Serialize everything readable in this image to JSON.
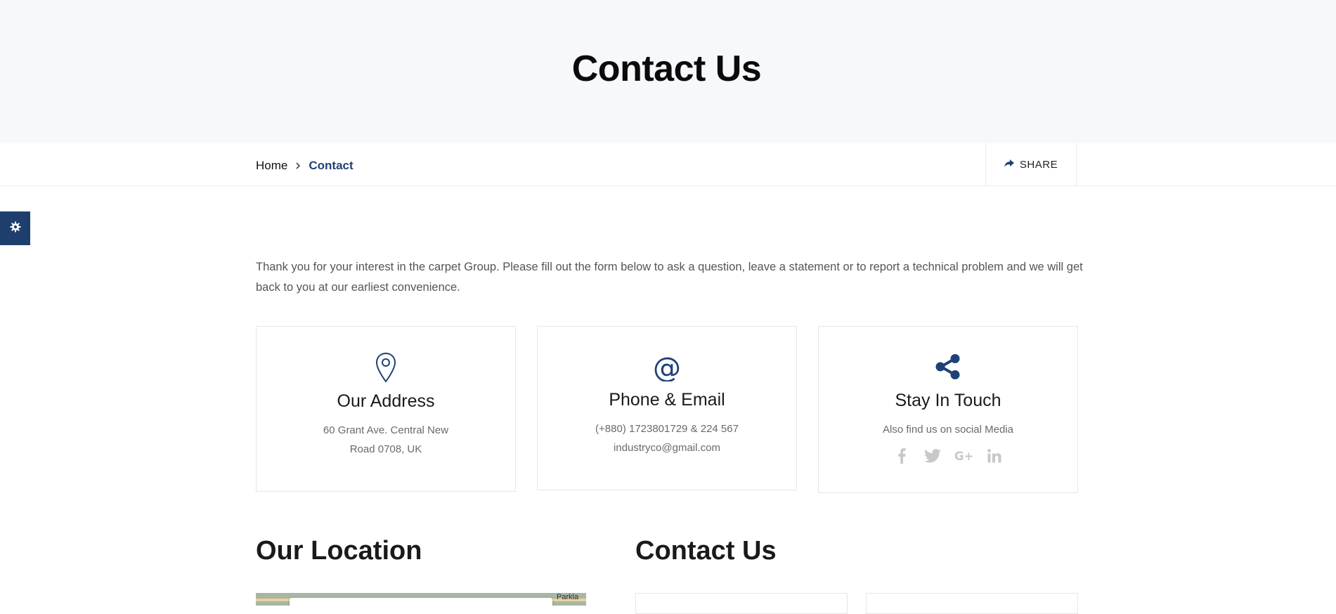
{
  "hero": {
    "title": "Contact Us"
  },
  "breadcrumb": {
    "home": "Home",
    "current": "Contact"
  },
  "share": {
    "label": "SHARE",
    "icon": "share-arrow-icon"
  },
  "settings": {
    "icon": "gear-icon"
  },
  "intro": "Thank you for your interest in the carpet Group. Please fill out the form below to ask a question, leave a statement or to report a technical problem and we will get back to you at our earliest convenience.",
  "cards": [
    {
      "icon": "map-pin-icon",
      "title": "Our Address",
      "lines": [
        "60 Grant Ave. Central New",
        "Road 0708, UK"
      ]
    },
    {
      "icon": "at-sign-icon",
      "title": "Phone & Email",
      "lines": [
        "(+880) 1723801729 & 224 567",
        "industryco@gmail.com"
      ]
    },
    {
      "icon": "share-icon",
      "title": "Stay In Touch",
      "lines": [
        "Also find us on social Media"
      ],
      "social": [
        "facebook-icon",
        "twitter-icon",
        "google-plus-icon",
        "linkedin-icon"
      ]
    }
  ],
  "location": {
    "title": "Our Location",
    "map_place": "Parkla"
  },
  "contact_form": {
    "title": "Contact Us"
  },
  "colors": {
    "accent": "#1e4276",
    "hero_bg": "#f7f8fb",
    "settings_bg": "#1e3f6e"
  }
}
